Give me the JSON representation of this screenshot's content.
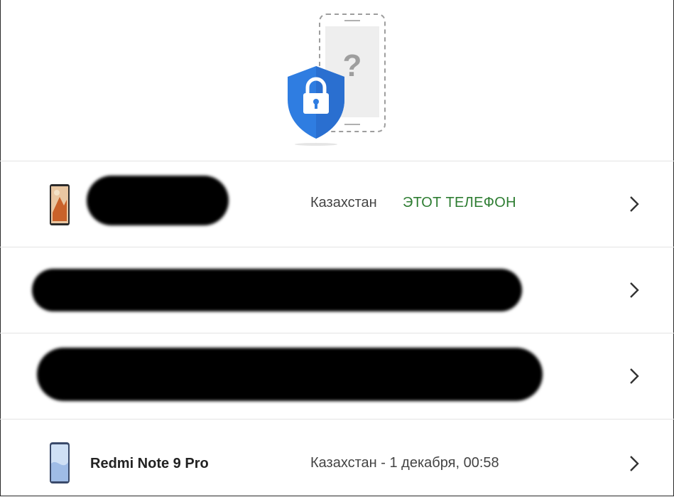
{
  "rows": [
    {
      "region": "Казахстан",
      "tag": "ЭТОТ ТЕЛЕФОН"
    },
    {},
    {},
    {
      "device_name": "Redmi Note 9 Pro",
      "region_time": "Казахстан - 1 декабря, 00:58"
    }
  ],
  "icons": {
    "hero": "shield-lock-phone-icon",
    "chevron": "chevron-right-icon"
  },
  "colors": {
    "shield": "#2f7de1",
    "current_device_tag": "#2e7d32"
  }
}
